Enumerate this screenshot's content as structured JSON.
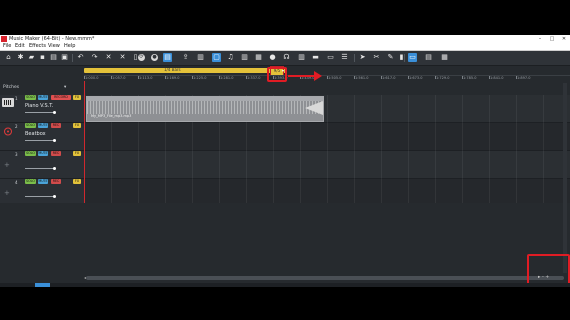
{
  "window": {
    "title": "Music Maker (64-Bit) - New.mmm*",
    "minimize": "–",
    "maximize": "□",
    "close": "✕"
  },
  "menu": [
    "File",
    "Edit",
    "Effects",
    "View",
    "Help"
  ],
  "toolbar": {
    "icons": [
      "home-icon",
      "gear-icon",
      "folder-open-icon",
      "save-icon",
      "document-icon",
      "panel-icon",
      "undo-icon",
      "redo-icon",
      "cut-icon",
      "delete-icon",
      "copy-icon",
      "loop-icon",
      "record-icon",
      "overview-icon",
      "upload-icon",
      "mixer-icon",
      "video-icon",
      "grid-icon",
      "keyboard-icon",
      "beat-icon",
      "headphones-icon",
      "stack-icon",
      "clip-icon",
      "sequence-icon",
      "list-icon",
      "pointer-icon",
      "scissors-icon",
      "draw-icon",
      "eraser-icon",
      "screen-icon",
      "export-icon",
      "settings-icon"
    ]
  },
  "ruler": {
    "loop_label": "1/4 Bars",
    "end_marker": "9/5",
    "ticks": [
      "1:000.0",
      "1:057.0",
      "1:113.0",
      "1:169.0",
      "1:225.0",
      "1:281.0",
      "1:337.0",
      "1:393.0",
      "1:449.0",
      "1:505.0",
      "1:561.0",
      "1:617.0",
      "1:673.0",
      "1:729.0",
      "1:785.0",
      "1:841.0",
      "1:897.0"
    ]
  },
  "tracks_header": {
    "label": "Pitches",
    "toggle": "▾"
  },
  "tracks": [
    {
      "number": "1",
      "name": "Piano V.S.T.",
      "solo": "SOLO",
      "mute": "MUTE",
      "rec": "RECORD",
      "extra": "FX"
    },
    {
      "number": "2",
      "name": "Beatbox",
      "solo": "SOLO",
      "mute": "MUTE",
      "rec": "REC",
      "extra": "FX"
    },
    {
      "number": "3",
      "name": "",
      "solo": "SOLO",
      "mute": "MUTE",
      "rec": "REC",
      "extra": "FX"
    },
    {
      "number": "4",
      "name": "",
      "solo": "SOLO",
      "mute": "MUTE",
      "rec": "REC",
      "extra": "FX"
    }
  ],
  "clip": {
    "name": "My_MP3_File_mp3.mp3"
  },
  "scroll": {
    "left_arrow": "◂",
    "zoom_controls": "▸ – +"
  }
}
